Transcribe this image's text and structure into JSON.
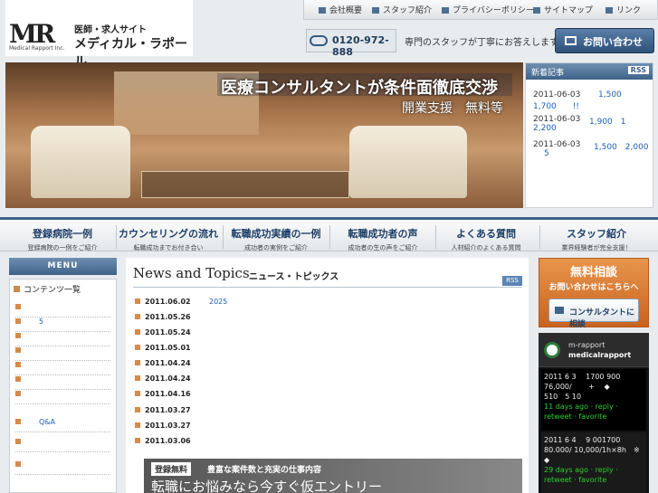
{
  "header": {
    "logo_mark": "MR",
    "logo_sub": "Medical Rapport Inc.",
    "site_tag": "医師・求人サイト",
    "site_name": "メディカル・ラポール",
    "topnav": [
      "会社概要",
      "スタッフ紹介",
      "プライバシーポリシー",
      "サイトマップ",
      "リンク"
    ],
    "phone": "0120-972-888",
    "phone_msg": "専門のスタッフが丁寧にお答えします",
    "contact_btn": "お問い合わせ"
  },
  "hero": {
    "line1": "医療コンサルタントが条件面徹底交渉",
    "line2": "開業支援　無料等"
  },
  "new_articles": {
    "title": "新着記事",
    "rss": "RSS",
    "items": [
      {
        "date": "2011-06-03",
        "text": "1,500",
        "text2": "1,700　　!!"
      },
      {
        "date": "2011-06-03",
        "text": "1,900　1",
        "text2": "2,200"
      },
      {
        "date": "2011-06-03",
        "text": "1,500　2,000",
        "text2": "5"
      }
    ]
  },
  "mainnav": [
    {
      "title": "登録病院一例",
      "sub": "登録病院の一例をご紹介"
    },
    {
      "title": "カウンセリングの流れ",
      "sub": "転職成功までお付き合い"
    },
    {
      "title": "転職成功実績の一例",
      "sub": "成功者の実例をご紹介"
    },
    {
      "title": "転職成功者の声",
      "sub": "成功者の生の声をご紹介"
    },
    {
      "title": "よくある質問",
      "sub": "人材紹介のよくある質問"
    },
    {
      "title": "スタッフ紹介",
      "sub": "業界経験者が完全支援！"
    }
  ],
  "menu": {
    "head": "MENU",
    "title": "コンテンツ一覧",
    "items": [
      "",
      "5",
      "",
      "",
      "",
      "",
      "",
      "Q&A",
      "",
      ""
    ]
  },
  "news": {
    "title": "News and Topics",
    "subtitle": "ニュース・トピックス",
    "rss": "RSS",
    "items": [
      {
        "date": "2011.06.02",
        "text": "2025"
      },
      {
        "date": "2011.05.26",
        "text": ""
      },
      {
        "date": "2011.05.24",
        "text": ""
      },
      {
        "date": "2011.05.01",
        "text": ""
      },
      {
        "date": "2011.04.24",
        "text": ""
      },
      {
        "date": "2011.04.24",
        "text": ""
      },
      {
        "date": "2011.04.16",
        "text": ""
      },
      {
        "date": "2011.03.27",
        "text": ""
      },
      {
        "date": "2011.03.27",
        "text": ""
      },
      {
        "date": "2011.03.06",
        "text": ""
      }
    ]
  },
  "entry_banner": {
    "badge": "登録無料",
    "sub": "豊富な案件数と充実の仕事内容",
    "main": "転職にお悩みなら今すぐ仮エントリー"
  },
  "consult": {
    "title": "無料相談",
    "sub": "お問い合わせはこちらへ",
    "btn": "コンサルタントに相談"
  },
  "twitter": {
    "user1": "m-rapport",
    "user2": "medicalrapport",
    "tweets": [
      {
        "text": "2011 6 3　 1700 900 76,000/　　 + 　◆　　　　 510　5 10",
        "meta": "11 days ago · reply · retweet · favorite"
      },
      {
        "text": "2011 6 4　 9 001700 80.000/ 10,000/1h×8h　※　◆",
        "meta": "29 days ago · reply · retweet · favorite"
      }
    ]
  }
}
